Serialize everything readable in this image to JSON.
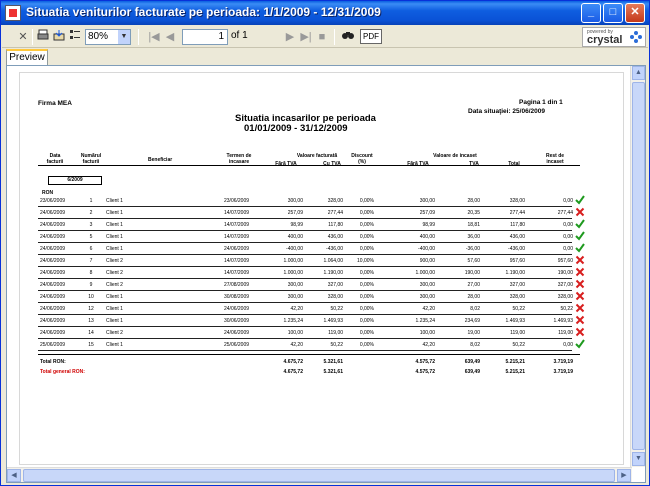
{
  "window": {
    "title": "Situatia veniturilor facturate pe perioada: 1/1/2009 - 12/31/2009",
    "minimize_glyph": "_",
    "maximize_glyph": "□",
    "close_glyph": "✕"
  },
  "toolbar": {
    "zoom_value": "80%",
    "page_value": "1",
    "page_of": "of 1",
    "export_label": "PDF",
    "brand_small": "powered by",
    "brand_large": "crystal"
  },
  "tab_label": "Preview",
  "report": {
    "company": "Firma MEA",
    "page_info": "Pagina 1 din 1",
    "date_label": "Data situaţiei: 25/06/2009",
    "title": "Situatia incasarilor pe perioada",
    "period": "01/01/2009 - 31/12/2009",
    "headers": {
      "date": "Data\nfacturii",
      "number": "Numărul\nfacturii",
      "client": "Beneficiar",
      "term": "Termen de\nincasare",
      "invoiced_group": "Valoare facturată",
      "no_vat": "Fără TVA",
      "with_vat": "Cu TVA",
      "discount": "Discount\n(%)",
      "collected_group": "Valoare de incaset",
      "coll_no_vat": "Fără TVA",
      "vat": "TVA",
      "total": "Total",
      "remaining": "Rest de\nincaset"
    },
    "month_group": "6/2009",
    "currency": "RON",
    "rows": [
      {
        "date": "23/06/2009",
        "no": "1",
        "client": "Client 1",
        "term": "23/06/2009",
        "fara": "300,00",
        "cu": "328,00",
        "disc": "0,00%",
        "inc_fara": "300,00",
        "tva": "28,00",
        "total": "328,00",
        "rest": "0,00",
        "status": "ok"
      },
      {
        "date": "24/06/2009",
        "no": "2",
        "client": "Client 1",
        "term": "14/07/2009",
        "fara": "257,09",
        "cu": "277,44",
        "disc": "0,00%",
        "inc_fara": "257,09",
        "tva": "20,35",
        "total": "277,44",
        "rest": "277,44",
        "status": "x"
      },
      {
        "date": "24/06/2009",
        "no": "3",
        "client": "Client 1",
        "term": "14/07/2009",
        "fara": "98,99",
        "cu": "117,80",
        "disc": "0,00%",
        "inc_fara": "98,99",
        "tva": "18,81",
        "total": "117,80",
        "rest": "0,00",
        "status": "ok"
      },
      {
        "date": "24/06/2009",
        "no": "5",
        "client": "Client 1",
        "term": "14/07/2009",
        "fara": "400,00",
        "cu": "436,00",
        "disc": "0,00%",
        "inc_fara": "400,00",
        "tva": "36,00",
        "total": "436,00",
        "rest": "0,00",
        "status": "ok"
      },
      {
        "date": "24/06/2009",
        "no": "6",
        "client": "Client 1",
        "term": "24/06/2009",
        "fara": "-400,00",
        "cu": "-436,00",
        "disc": "0,00%",
        "inc_fara": "-400,00",
        "tva": "-36,00",
        "total": "-436,00",
        "rest": "0,00",
        "status": "ok"
      },
      {
        "date": "24/06/2009",
        "no": "7",
        "client": "Client 2",
        "term": "14/07/2009",
        "fara": "1.000,00",
        "cu": "1.064,00",
        "disc": "10,00%",
        "inc_fara": "900,00",
        "tva": "57,60",
        "total": "957,60",
        "rest": "957,60",
        "status": "x"
      },
      {
        "date": "24/06/2009",
        "no": "8",
        "client": "Client 2",
        "term": "14/07/2009",
        "fara": "1.000,00",
        "cu": "1.190,00",
        "disc": "0,00%",
        "inc_fara": "1.000,00",
        "tva": "190,00",
        "total": "1.190,00",
        "rest": "190,00",
        "status": "x"
      },
      {
        "date": "24/06/2009",
        "no": "9",
        "client": "Client 2",
        "term": "27/08/2009",
        "fara": "300,00",
        "cu": "327,00",
        "disc": "0,00%",
        "inc_fara": "300,00",
        "tva": "27,00",
        "total": "327,00",
        "rest": "327,00",
        "status": "x"
      },
      {
        "date": "24/06/2009",
        "no": "10",
        "client": "Client 1",
        "term": "30/08/2009",
        "fara": "300,00",
        "cu": "328,00",
        "disc": "0,00%",
        "inc_fara": "300,00",
        "tva": "28,00",
        "total": "328,00",
        "rest": "328,00",
        "status": "x"
      },
      {
        "date": "24/06/2009",
        "no": "12",
        "client": "Client 1",
        "term": "24/06/2009",
        "fara": "42,20",
        "cu": "50,22",
        "disc": "0,00%",
        "inc_fara": "42,20",
        "tva": "8,02",
        "total": "50,22",
        "rest": "50,22",
        "status": "x"
      },
      {
        "date": "24/06/2009",
        "no": "13",
        "client": "Client 1",
        "term": "30/06/2009",
        "fara": "1.235,24",
        "cu": "1.469,93",
        "disc": "0,00%",
        "inc_fara": "1.235,24",
        "tva": "234,69",
        "total": "1.469,93",
        "rest": "1.469,93",
        "status": "x"
      },
      {
        "date": "24/06/2009",
        "no": "14",
        "client": "Client 2",
        "term": "24/06/2009",
        "fara": "100,00",
        "cu": "119,00",
        "disc": "0,00%",
        "inc_fara": "100,00",
        "tva": "19,00",
        "total": "119,00",
        "rest": "119,00",
        "status": "x"
      },
      {
        "date": "25/06/2009",
        "no": "15",
        "client": "Client 1",
        "term": "25/06/2009",
        "fara": "42,20",
        "cu": "50,22",
        "disc": "0,00%",
        "inc_fara": "42,20",
        "tva": "8,02",
        "total": "50,22",
        "rest": "0,00",
        "status": "ok"
      }
    ],
    "total": {
      "label": "Total RON:",
      "fara": "4.675,72",
      "cu": "5.321,61",
      "inc_fara": "4.575,72",
      "tva": "639,49",
      "total": "5.215,21",
      "rest": "3.719,19"
    },
    "grand_total": {
      "label": "Total general RON:",
      "fara": "4.675,72",
      "cu": "5.321,61",
      "inc_fara": "4.575,72",
      "tva": "639,49",
      "total": "5.215,21",
      "rest": "3.719,19"
    }
  },
  "colors": {
    "ok": "#1f9a1f",
    "x": "#d81e1e",
    "title_bar": "#0a52d6"
  }
}
